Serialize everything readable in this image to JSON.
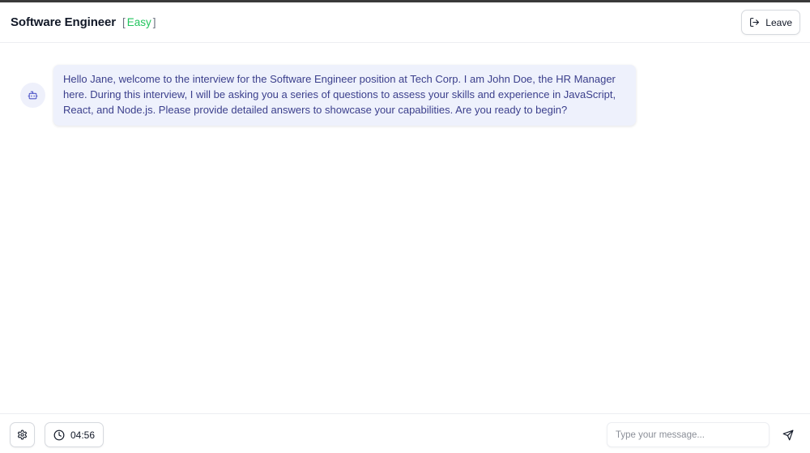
{
  "header": {
    "title": "Software Engineer",
    "difficulty_open": "[",
    "difficulty": "Easy",
    "difficulty_close": "]",
    "leave_label": "Leave"
  },
  "messages": [
    {
      "sender_icon": "bot-icon",
      "text": "Hello Jane, welcome to the interview for the Software Engineer position at Tech Corp. I am John Doe, the HR Manager here. During this interview, I will be asking you a series of questions to assess your skills and experience in JavaScript, React, and Node.js. Please provide detailed answers to showcase your capabilities. Are you ready to begin?"
    }
  ],
  "footer": {
    "timer": "04:56",
    "input_placeholder": "Type your message...",
    "input_value": ""
  },
  "colors": {
    "accent_easy": "#22c55e",
    "bubble_bg": "#eef1fc",
    "bubble_text": "#3b3f8c"
  }
}
